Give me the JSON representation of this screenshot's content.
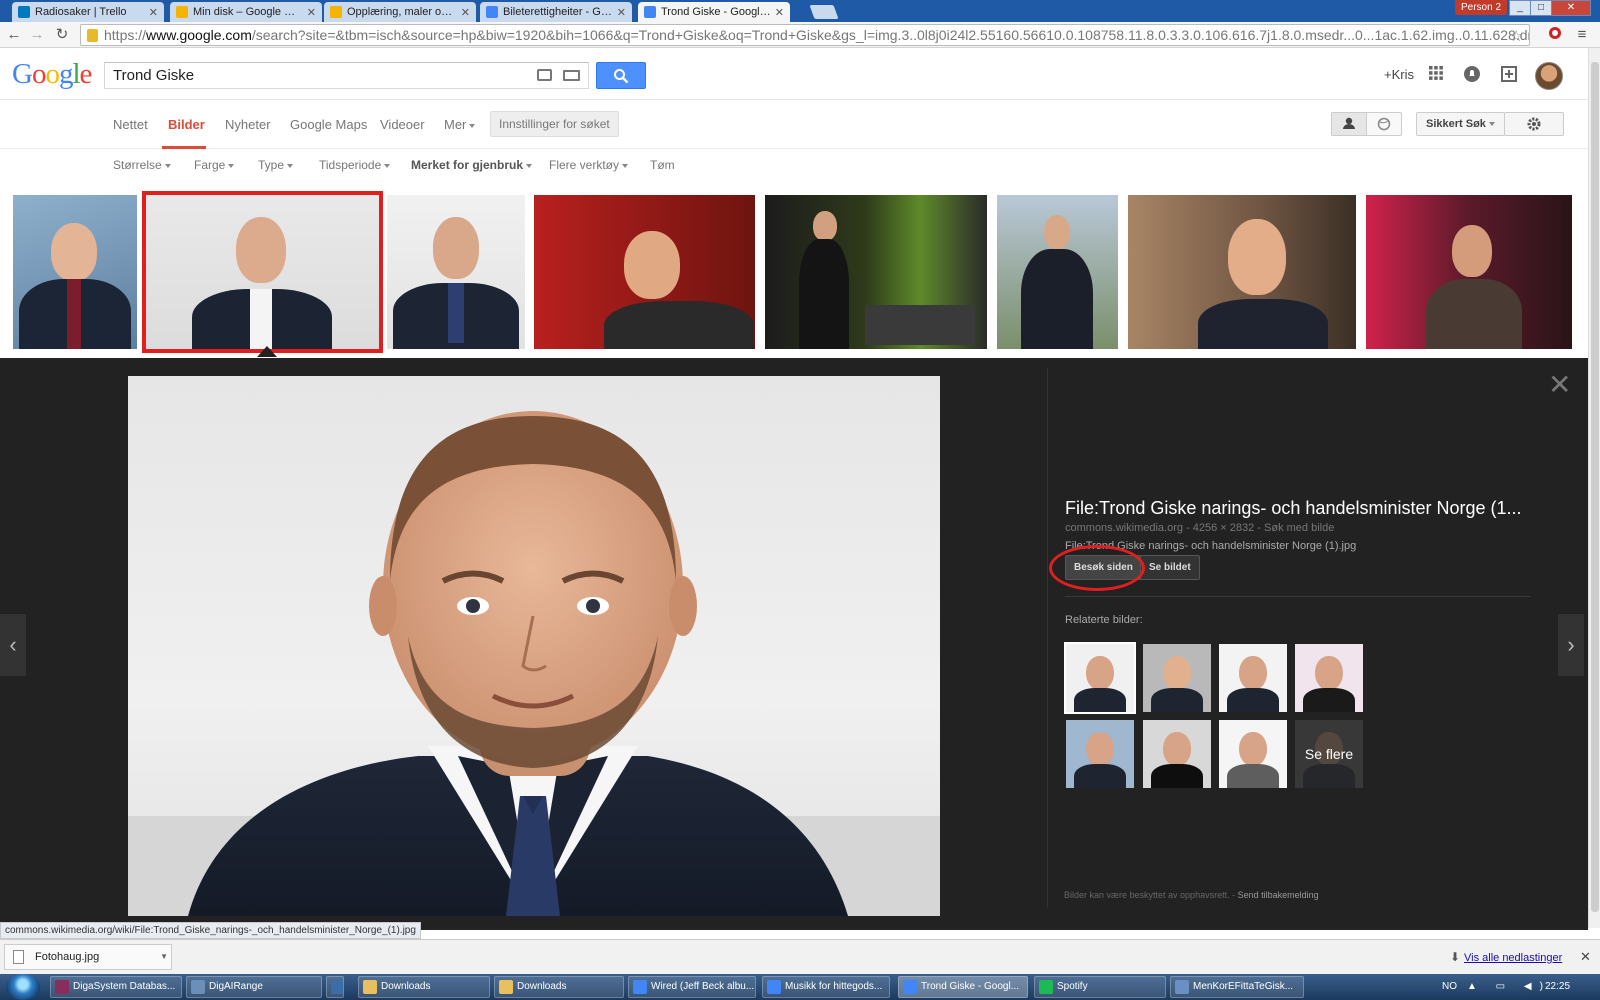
{
  "browser": {
    "tabs": [
      {
        "label": "Radiosaker | Trello",
        "color": "#0079bf"
      },
      {
        "label": "Min disk – Google Disk",
        "color": "#f4b400"
      },
      {
        "label": "Opplæring, maler og div...",
        "color": "#f4b400"
      },
      {
        "label": "Bileterettigheiter - Google...",
        "color": "#4285f4"
      },
      {
        "label": "Trond Giske - Google-søk",
        "color": "#4285f4"
      }
    ],
    "active_tab": 4,
    "profile": "Person 2",
    "url": {
      "scheme": "https://",
      "host": "www.google.com",
      "rest": "/search?site=&tbm=isch&source=hp&biw=1920&bih=1066&q=Trond+Giske&oq=Trond+Giske&gs_l=img.3..0l8j0i24l2.55160.56610.0.108758.11.8.0.3.3.0.106.616.7j1.8.0.msedr...0...1ac.1.62.img..0.11.628.dr7ialxpqQA#q"
    }
  },
  "google": {
    "logo_letters": [
      {
        "ch": "G",
        "color": "#4285f4"
      },
      {
        "ch": "o",
        "color": "#ea4335"
      },
      {
        "ch": "o",
        "color": "#fbbc05"
      },
      {
        "ch": "g",
        "color": "#4285f4"
      },
      {
        "ch": "l",
        "color": "#34a853"
      },
      {
        "ch": "e",
        "color": "#ea4335"
      }
    ],
    "query": "Trond Giske",
    "user_link": "+Kris",
    "vertical_tabs": [
      "Nettet",
      "Bilder",
      "Nyheter",
      "Google Maps",
      "Videoer",
      "Mer"
    ],
    "active_vertical": "Bilder",
    "settings_button": "Innstillinger for søket",
    "safesearch": "Sikkert Søk",
    "tools": [
      "Størrelse",
      "Farge",
      "Type",
      "Tidsperiode",
      "Merket for gjenbruk",
      "Flere verktøy",
      "Tøm"
    ],
    "bold_tool": "Merket for gjenbruk"
  },
  "viewer": {
    "title": "File:Trond Giske narings- och handelsminister Norge (1...",
    "meta": "commons.wikimedia.org - 4256 × 2832 - Søk med bilde",
    "filename": "File:Trond Giske narings- och handelsminister Norge (1).jpg",
    "visit_button": "Besøk siden",
    "view_button": "Se bildet",
    "related_label": "Relaterte bilder:",
    "see_more": "Se flere",
    "copyright": "Bilder kan være beskyttet av opphavsrett.",
    "feedback": "Send tilbakemelding"
  },
  "status_url": "commons.wikimedia.org/wiki/File:Trond_Giske_narings-_och_handelsminister_Norge_(1).jpg",
  "downloads": {
    "file": "Fotohaug.jpg",
    "show_all": "Vis alle nedlastinger"
  },
  "taskbar": {
    "items": [
      {
        "label": "DigaSystem Databas...",
        "color": "#8a2d5c"
      },
      {
        "label": "DigAIRange",
        "color": "#6a8fb8"
      },
      {
        "label": "",
        "color": "#3b6ea8"
      },
      {
        "label": "Downloads",
        "color": "#e8c060"
      },
      {
        "label": "Downloads",
        "color": "#e8c060"
      },
      {
        "label": "Wired (Jeff Beck albu...",
        "color": "#4285f4"
      },
      {
        "label": "Musikk for hittegods...",
        "color": "#4285f4"
      },
      {
        "label": "Trond Giske - Googl...",
        "color": "#4285f4"
      },
      {
        "label": "Spotify",
        "color": "#1db954"
      },
      {
        "label": "MenKorEFittaTeGisk...",
        "color": "#6b8fc4"
      }
    ],
    "active_item": 7,
    "lang": "NO",
    "time": "22:25"
  }
}
